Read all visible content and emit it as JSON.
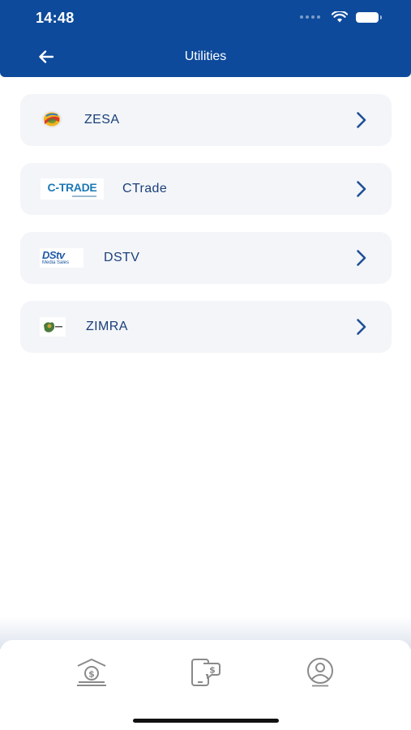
{
  "status_bar": {
    "time": "14:48"
  },
  "header": {
    "title": "Utilities",
    "back_icon": "arrow-left-icon"
  },
  "utilities": [
    {
      "label": "ZESA",
      "logo": "zesa-logo"
    },
    {
      "label": "CTrade",
      "logo": "ctrade-logo",
      "logo_text": "C-TRADE"
    },
    {
      "label": "DSTV",
      "logo": "dstv-logo",
      "logo_text": "DStv",
      "logo_subtext": "Media Sales"
    },
    {
      "label": "ZIMRA",
      "logo": "zimra-logo"
    }
  ],
  "tabbar": {
    "tabs": [
      {
        "icon": "bank-dollar-icon"
      },
      {
        "icon": "phone-payment-icon"
      },
      {
        "icon": "profile-icon"
      }
    ]
  },
  "colors": {
    "header_bg": "#0d4a9b",
    "card_bg": "#f3f5f8",
    "label_text": "#1a3f7a",
    "chevron": "#1f4f96",
    "tab_icon": "#8a8a8a"
  }
}
